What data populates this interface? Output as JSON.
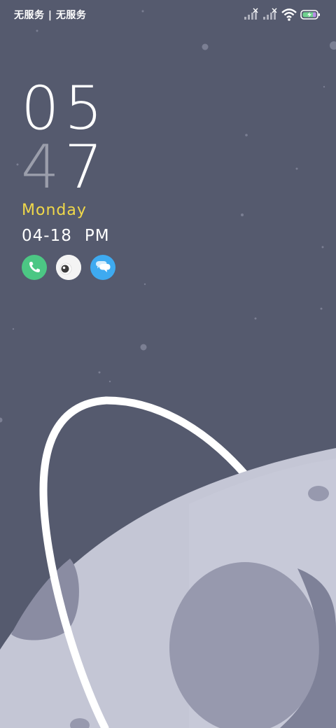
{
  "status_bar": {
    "carrier": "无服务 | 无服务",
    "icons": [
      "signal-1-icon",
      "signal-2-icon",
      "wifi-icon",
      "battery-charging-icon"
    ]
  },
  "clock": {
    "hour_tens": "0",
    "hour_ones": "5",
    "minute_tens": "4",
    "minute_ones": "7"
  },
  "weekday": "Monday",
  "date": "04-18",
  "ampm": "PM",
  "shortcuts": [
    {
      "name": "phone-shortcut",
      "icon": "phone-icon",
      "color": "#4cc784"
    },
    {
      "name": "camera-shortcut",
      "icon": "camera-eye-icon",
      "color": "#f4f4f4"
    },
    {
      "name": "messages-shortcut",
      "icon": "chat-bubble-icon",
      "color": "#3eaaf0"
    }
  ],
  "colors": {
    "background": "#555a6e",
    "weekday": "#f0d84a",
    "planet": "#c5c7d6",
    "crater": "#9a9cb0",
    "ring": "#ffffff"
  }
}
